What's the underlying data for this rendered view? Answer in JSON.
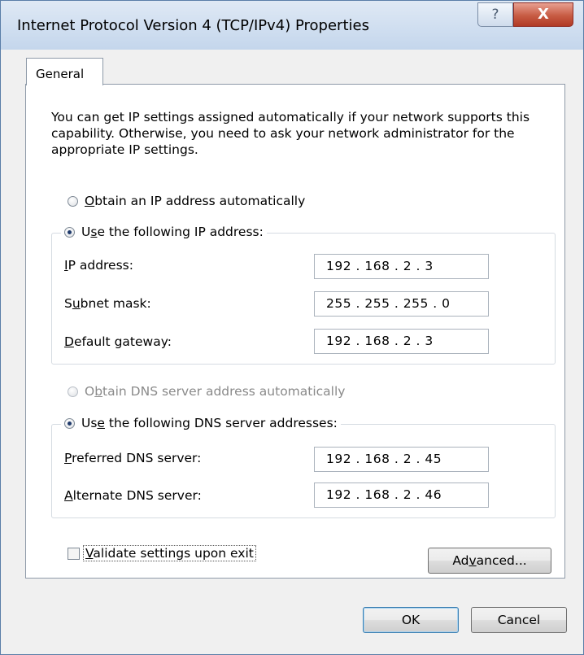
{
  "window": {
    "title": "Internet Protocol Version 4 (TCP/IPv4) Properties",
    "help_glyph": "?",
    "close_glyph": "X"
  },
  "tabs": [
    {
      "label": "General",
      "active": true
    }
  ],
  "description": "You can get IP settings assigned automatically if your network supports this capability. Otherwise, you need to ask your network administrator for the appropriate IP settings.",
  "ip_mode": {
    "auto": {
      "pre": "",
      "mnemonic": "O",
      "post": "btain an IP address automatically",
      "checked": false,
      "enabled": true
    },
    "manual": {
      "pre": "U",
      "mnemonic": "s",
      "post": "e the following IP address:",
      "checked": true,
      "enabled": true
    }
  },
  "ip_fields": [
    {
      "pre": "",
      "mnemonic": "I",
      "post": "P address:",
      "value": "192 . 168 .  2  .  3"
    },
    {
      "pre": "S",
      "mnemonic": "u",
      "post": "bnet mask:",
      "value": "255 . 255 . 255 .  0"
    },
    {
      "pre": "",
      "mnemonic": "D",
      "post": "efault gateway:",
      "value": "192 . 168 .  2  .  3"
    }
  ],
  "dns_mode": {
    "auto": {
      "pre": "O",
      "mnemonic": "b",
      "post": "tain DNS server address automatically",
      "checked": false,
      "enabled": false
    },
    "manual": {
      "pre": "Us",
      "mnemonic": "e",
      "post": " the following DNS server addresses:",
      "checked": true,
      "enabled": true
    }
  },
  "dns_fields": [
    {
      "pre": "",
      "mnemonic": "P",
      "post": "referred DNS server:",
      "value": "192 . 168 .  2  . 45"
    },
    {
      "pre": "",
      "mnemonic": "A",
      "post": "lternate DNS server:",
      "value": "192 . 168 .  2  . 46"
    }
  ],
  "validate": {
    "pre": "",
    "mnemonic": "V",
    "post": "alidate settings upon exit",
    "checked": false
  },
  "buttons": {
    "advanced": {
      "pre": "Ad",
      "mnemonic": "v",
      "post": "anced..."
    },
    "ok": "OK",
    "cancel": "Cancel"
  },
  "colors": {
    "accent": "#1f3a6b",
    "window_border": "#5a7ea8",
    "close_button": "#c75b43"
  }
}
